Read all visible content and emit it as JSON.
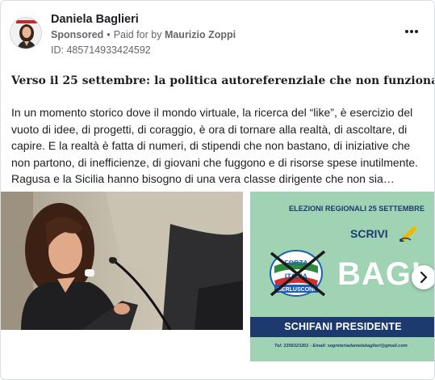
{
  "advertiser": {
    "name": "Daniela Baglieri",
    "sponsored_label": "Sponsored",
    "separator": "•",
    "paid_for_prefix": "Paid for by",
    "payer": "Maurizio Zoppi",
    "ad_id": "ID: 485714933424592"
  },
  "post": {
    "title": "Verso il 25 settembre: la politica autoreferenziale che non funziona",
    "lines": [
      "In un momento storico dove il mondo virtuale, la ricerca del “like”, è esercizio del",
      "vuoto di idee, di progetti, di coraggio, è ora di tornare alla realtà, di ascoltare, di",
      "capire. E la realtà è fatta di numeri, di stipendi che non bastano, di iniziative che",
      "non partono, di inefficienze, di giovani che fuggono e di risorse spese inutilmente.",
      "Ragusa e la Sicilia hanno bisogno di una vera classe dirigente che non sia…"
    ]
  },
  "banner": {
    "headline": "ELEZIONI REGIONALI 25 SETTEMBRE",
    "call_to_action": "SCRIVI",
    "surname": "BAGLI",
    "party_logo_text": [
      "FORZA",
      "ITALIA",
      "BERLUSCONI"
    ],
    "president_line": "SCHIFANI PRESIDENTE",
    "contacts": "Tel: 3358323301 - Email: segreteriadanielabaglieri@gmail.com"
  },
  "icons": {
    "more": "more-horizontal-icon",
    "next": "chevron-right-icon"
  },
  "colors": {
    "banner_green": "#9fd3b3",
    "banner_navy": "#1c3a6e",
    "forza_italia_blue": "#1e5fb5"
  }
}
